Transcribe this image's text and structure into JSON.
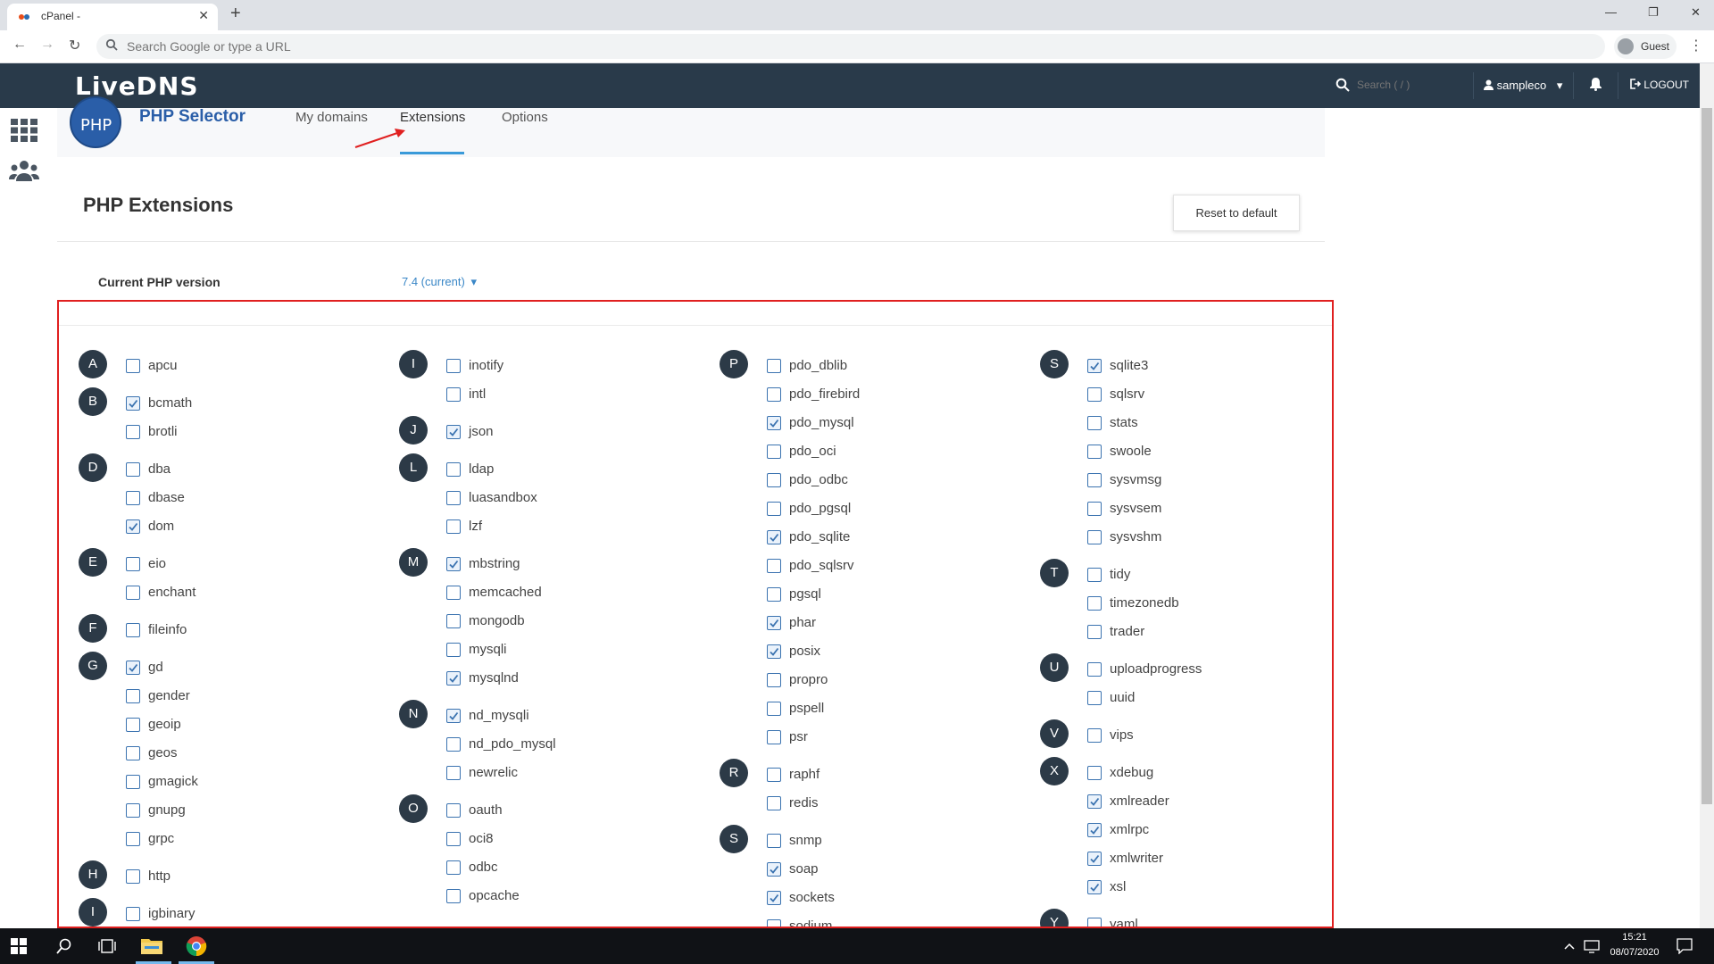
{
  "browser": {
    "tab_title": "cPanel -",
    "new_tab_symbol": "+",
    "close_symbol": "✕",
    "minimize_symbol": "—",
    "restore_symbol": "❐",
    "window_close_symbol": "✕",
    "back_symbol": "←",
    "forward_symbol": "→",
    "reload_symbol": "↻",
    "omnibox_placeholder": "Search Google or type a URL",
    "profile_label": "Guest",
    "menu_symbol": "⋮"
  },
  "header": {
    "logo": "LiveDNS",
    "search_placeholder": "Search ( / )",
    "username": "sampleco",
    "user_caret": "▾",
    "logout": "LOGOUT"
  },
  "app": {
    "logo_text": "PHP",
    "title": "PHP Selector",
    "tabs": [
      {
        "label": "My domains",
        "active": false
      },
      {
        "label": "Extensions",
        "active": true
      },
      {
        "label": "Options",
        "active": false
      }
    ]
  },
  "main": {
    "section_title": "PHP Extensions",
    "reset_label": "Reset to default",
    "version_label": "Current PHP version",
    "version_value": "7.4 (current)",
    "version_caret": "▾"
  },
  "extension_columns": [
    [
      {
        "letter": "A",
        "items": [
          {
            "name": "apcu",
            "checked": false
          }
        ]
      },
      {
        "letter": "B",
        "items": [
          {
            "name": "bcmath",
            "checked": true
          },
          {
            "name": "brotli",
            "checked": false
          }
        ]
      },
      {
        "letter": "D",
        "items": [
          {
            "name": "dba",
            "checked": false
          },
          {
            "name": "dbase",
            "checked": false
          },
          {
            "name": "dom",
            "checked": true
          }
        ]
      },
      {
        "letter": "E",
        "items": [
          {
            "name": "eio",
            "checked": false
          },
          {
            "name": "enchant",
            "checked": false
          }
        ]
      },
      {
        "letter": "F",
        "items": [
          {
            "name": "fileinfo",
            "checked": false
          }
        ]
      },
      {
        "letter": "G",
        "items": [
          {
            "name": "gd",
            "checked": true
          },
          {
            "name": "gender",
            "checked": false
          },
          {
            "name": "geoip",
            "checked": false
          },
          {
            "name": "geos",
            "checked": false
          },
          {
            "name": "gmagick",
            "checked": false
          },
          {
            "name": "gnupg",
            "checked": false
          },
          {
            "name": "grpc",
            "checked": false
          }
        ]
      },
      {
        "letter": "H",
        "items": [
          {
            "name": "http",
            "checked": false
          }
        ]
      },
      {
        "letter": "I",
        "items": [
          {
            "name": "igbinary",
            "checked": false
          }
        ]
      }
    ],
    [
      {
        "letter": "I",
        "items": [
          {
            "name": "inotify",
            "checked": false
          },
          {
            "name": "intl",
            "checked": false
          }
        ]
      },
      {
        "letter": "J",
        "items": [
          {
            "name": "json",
            "checked": true
          }
        ]
      },
      {
        "letter": "L",
        "items": [
          {
            "name": "ldap",
            "checked": false
          },
          {
            "name": "luasandbox",
            "checked": false
          },
          {
            "name": "lzf",
            "checked": false
          }
        ]
      },
      {
        "letter": "M",
        "items": [
          {
            "name": "mbstring",
            "checked": true
          },
          {
            "name": "memcached",
            "checked": false
          },
          {
            "name": "mongodb",
            "checked": false
          },
          {
            "name": "mysqli",
            "checked": false
          },
          {
            "name": "mysqlnd",
            "checked": true
          }
        ]
      },
      {
        "letter": "N",
        "items": [
          {
            "name": "nd_mysqli",
            "checked": true
          },
          {
            "name": "nd_pdo_mysql",
            "checked": false
          },
          {
            "name": "newrelic",
            "checked": false
          }
        ]
      },
      {
        "letter": "O",
        "items": [
          {
            "name": "oauth",
            "checked": false
          },
          {
            "name": "oci8",
            "checked": false
          },
          {
            "name": "odbc",
            "checked": false
          },
          {
            "name": "opcache",
            "checked": false
          }
        ]
      }
    ],
    [
      {
        "letter": "P",
        "items": [
          {
            "name": "pdo_dblib",
            "checked": false
          },
          {
            "name": "pdo_firebird",
            "checked": false
          },
          {
            "name": "pdo_mysql",
            "checked": true
          },
          {
            "name": "pdo_oci",
            "checked": false
          },
          {
            "name": "pdo_odbc",
            "checked": false
          },
          {
            "name": "pdo_pgsql",
            "checked": false
          },
          {
            "name": "pdo_sqlite",
            "checked": true
          },
          {
            "name": "pdo_sqlsrv",
            "checked": false
          },
          {
            "name": "pgsql",
            "checked": false
          },
          {
            "name": "phar",
            "checked": true
          },
          {
            "name": "posix",
            "checked": true
          },
          {
            "name": "propro",
            "checked": false
          },
          {
            "name": "pspell",
            "checked": false
          },
          {
            "name": "psr",
            "checked": false
          }
        ]
      },
      {
        "letter": "R",
        "items": [
          {
            "name": "raphf",
            "checked": false
          },
          {
            "name": "redis",
            "checked": false
          }
        ]
      },
      {
        "letter": "S",
        "items": [
          {
            "name": "snmp",
            "checked": false
          },
          {
            "name": "soap",
            "checked": true
          },
          {
            "name": "sockets",
            "checked": true
          },
          {
            "name": "sodium",
            "checked": false
          }
        ]
      }
    ],
    [
      {
        "letter": "S",
        "items": [
          {
            "name": "sqlite3",
            "checked": true
          },
          {
            "name": "sqlsrv",
            "checked": false
          },
          {
            "name": "stats",
            "checked": false
          },
          {
            "name": "swoole",
            "checked": false
          },
          {
            "name": "sysvmsg",
            "checked": false
          },
          {
            "name": "sysvsem",
            "checked": false
          },
          {
            "name": "sysvshm",
            "checked": false
          }
        ]
      },
      {
        "letter": "T",
        "items": [
          {
            "name": "tidy",
            "checked": false
          },
          {
            "name": "timezonedb",
            "checked": false
          },
          {
            "name": "trader",
            "checked": false
          }
        ]
      },
      {
        "letter": "U",
        "items": [
          {
            "name": "uploadprogress",
            "checked": false
          },
          {
            "name": "uuid",
            "checked": false
          }
        ]
      },
      {
        "letter": "V",
        "items": [
          {
            "name": "vips",
            "checked": false
          }
        ]
      },
      {
        "letter": "X",
        "items": [
          {
            "name": "xdebug",
            "checked": false
          },
          {
            "name": "xmlreader",
            "checked": true
          },
          {
            "name": "xmlrpc",
            "checked": true
          },
          {
            "name": "xmlwriter",
            "checked": true
          },
          {
            "name": "xsl",
            "checked": true
          }
        ]
      },
      {
        "letter": "Y",
        "items": [
          {
            "name": "yaml",
            "checked": false
          }
        ]
      }
    ]
  ],
  "taskbar": {
    "time": "15:21",
    "date": "08/07/2020"
  },
  "colors": {
    "header_bg": "#293a4a",
    "accent_blue": "#3a9ad9",
    "highlight_red": "#e02020",
    "letter_badge": "#2c3a47"
  }
}
